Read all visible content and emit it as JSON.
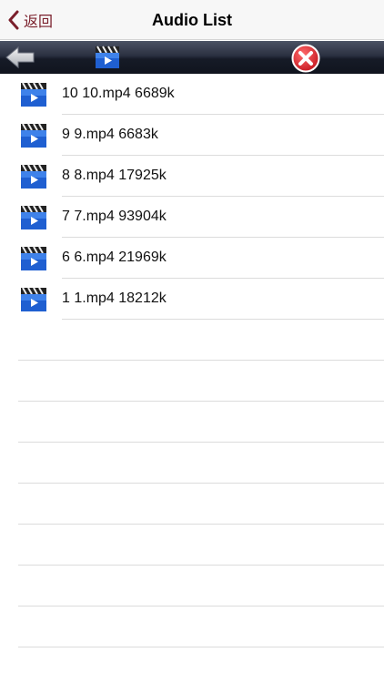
{
  "nav": {
    "back_label": "返回",
    "title": "Audio List"
  },
  "toolbar": {
    "back_icon": "left-arrow-icon",
    "media_icon": "clapperboard-icon",
    "close_icon": "close-icon"
  },
  "colors": {
    "accent": "#7a1f2b",
    "close_red": "#d9232e",
    "clap_blue": "#1f5fd1"
  },
  "files": [
    {
      "label": "10 10.mp4 6689k"
    },
    {
      "label": "9 9.mp4 6683k"
    },
    {
      "label": "8 8.mp4 17925k"
    },
    {
      "label": "7 7.mp4 93904k"
    },
    {
      "label": "6 6.mp4 21969k"
    },
    {
      "label": "1 1.mp4 18212k"
    }
  ]
}
